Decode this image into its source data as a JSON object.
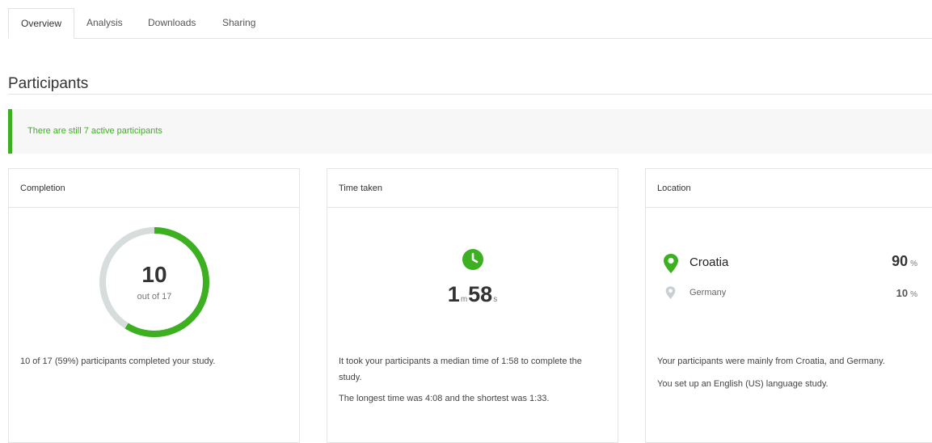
{
  "tabs": [
    {
      "label": "Overview",
      "active": true
    },
    {
      "label": "Analysis",
      "active": false
    },
    {
      "label": "Downloads",
      "active": false
    },
    {
      "label": "Sharing",
      "active": false
    }
  ],
  "section": {
    "title": "Participants"
  },
  "alert": {
    "text": "There are still 7 active participants"
  },
  "colors": {
    "accent": "#3cb021",
    "ring_track": "#d7dcdd"
  },
  "completion": {
    "title": "Completion",
    "completed": "10",
    "total_label": "out of 17",
    "progress_fraction": 0.59,
    "description": "10 of 17 (59%) participants completed your study."
  },
  "time_taken": {
    "title": "Time taken",
    "icon": "clock-icon",
    "minutes": "1",
    "minutes_unit": "m",
    "seconds": "58",
    "seconds_unit": "s",
    "description_1": "It took your participants a median time of 1:58 to complete the study.",
    "description_2": "The longest time was 4:08 and the shortest was 1:33."
  },
  "location": {
    "title": "Location",
    "countries": [
      {
        "name": "Croatia",
        "percent": "90",
        "unit": "%",
        "icon": "map-pin-icon"
      },
      {
        "name": "Germany",
        "percent": "10",
        "unit": "%",
        "icon": "map-pin-icon"
      }
    ],
    "description_1": "Your participants were mainly from Croatia, and Germany.",
    "description_2": "You set up an English (US) language study."
  }
}
